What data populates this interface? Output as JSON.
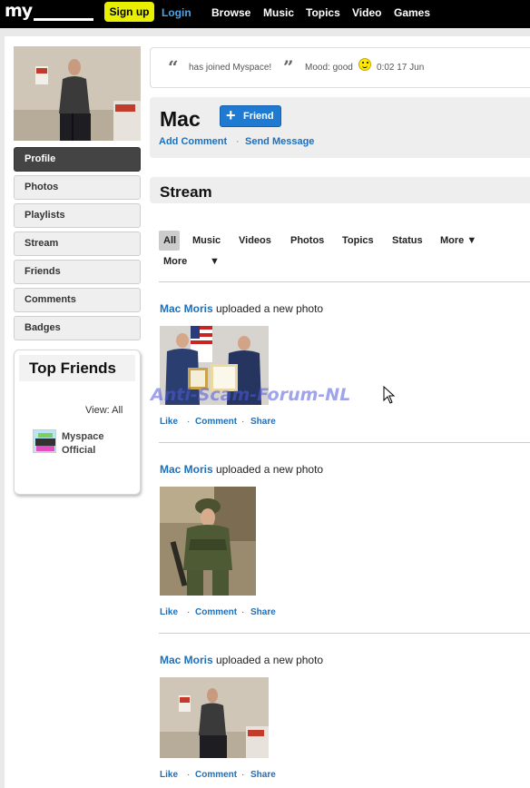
{
  "header": {
    "logo": "my",
    "signup_label": "Sign up",
    "login_label": "Login",
    "nav": [
      "Browse",
      "Music",
      "Topics",
      "Video",
      "Games"
    ]
  },
  "sidebar": {
    "items": [
      {
        "label": "Profile",
        "active": true
      },
      {
        "label": "Photos"
      },
      {
        "label": "Playlists"
      },
      {
        "label": "Stream"
      },
      {
        "label": "Friends"
      },
      {
        "label": "Comments"
      },
      {
        "label": "Badges"
      }
    ],
    "top_friends": {
      "title": "Top Friends",
      "view_all": "View: All",
      "friends": [
        {
          "name": "Myspace Official"
        }
      ]
    }
  },
  "status": {
    "text": "has joined Myspace!",
    "mood_label": "Mood: good",
    "timestamp": "0:02 17 Jun"
  },
  "profile": {
    "name": "Mac",
    "friend_button": "Friend",
    "add_comment": "Add Comment",
    "send_message": "Send Message"
  },
  "stream": {
    "title": "Stream",
    "filters": [
      "All",
      "Music",
      "Videos",
      "Photos",
      "Topics",
      "Status",
      "More ▼"
    ],
    "filters_row2": [
      "More",
      "▼"
    ],
    "posts": [
      {
        "author": "Mac Moris",
        "action": "uploaded a new photo",
        "like": "Like",
        "comment": "Comment",
        "share": "Share"
      },
      {
        "author": "Mac Moris",
        "action": "uploaded a new photo",
        "like": "Like",
        "comment": "Comment",
        "share": "Share"
      },
      {
        "author": "Mac Moris",
        "action": "uploaded a new photo",
        "like": "Like",
        "comment": "Comment",
        "share": "Share"
      }
    ]
  },
  "watermark": "Anti-Scam-Forum-NL",
  "colors": {
    "link": "#1d6fbb",
    "signup": "#e8f000",
    "login": "#4aa6e8",
    "friend_button": "#1f7bd1"
  }
}
